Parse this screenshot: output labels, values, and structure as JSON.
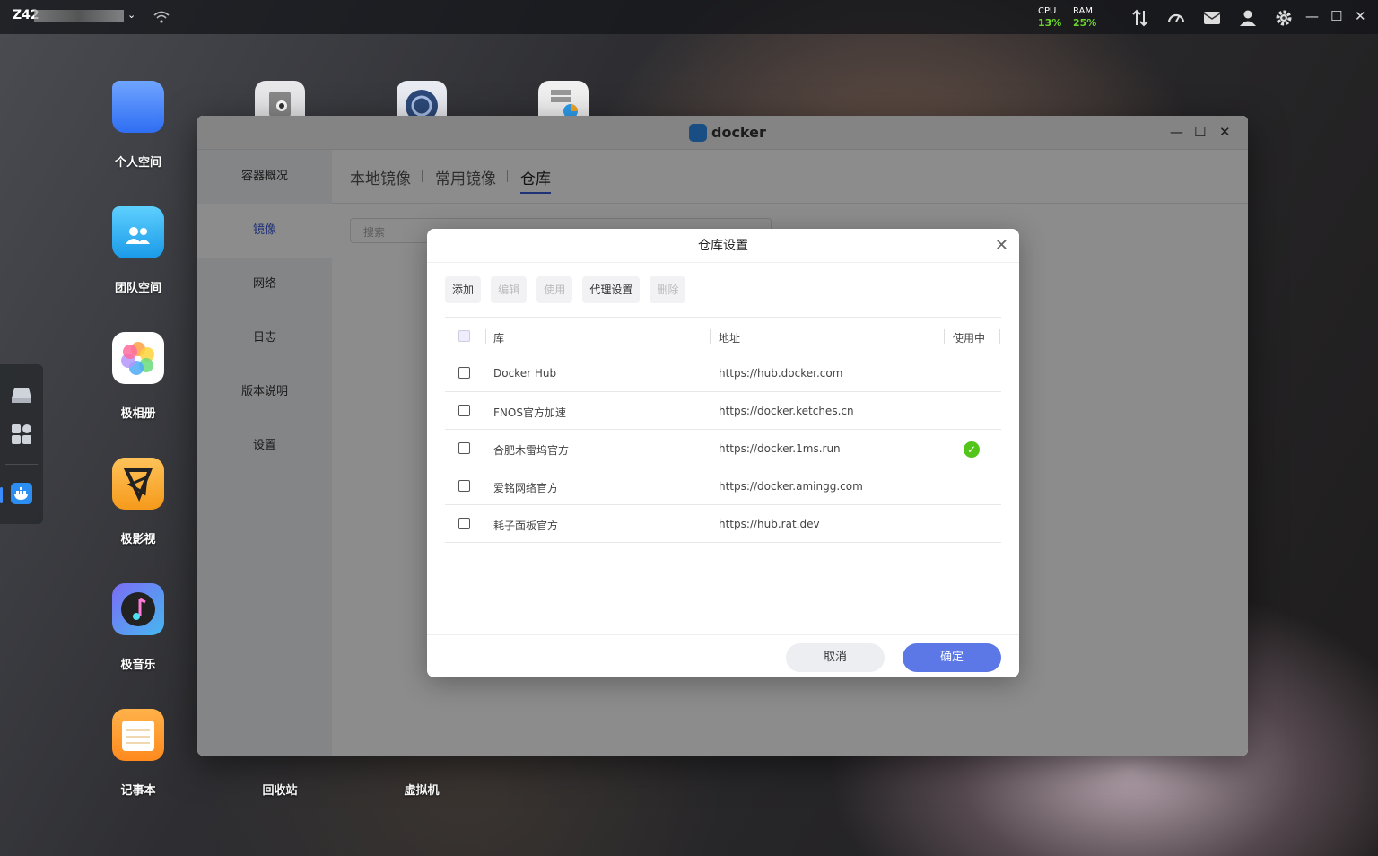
{
  "topbar": {
    "host": "Z42",
    "cpu_label": "CPU",
    "cpu_value": "13%",
    "ram_label": "RAM",
    "ram_value": "25%"
  },
  "desktop": {
    "apps": [
      {
        "label": "个人空间"
      },
      {
        "label": "团队空间"
      },
      {
        "label": "极相册"
      },
      {
        "label": "极影视"
      },
      {
        "label": "极音乐"
      },
      {
        "label": "记事本"
      },
      {
        "label": "回收站"
      },
      {
        "label": "虚拟机"
      }
    ]
  },
  "window": {
    "title": "docker",
    "sidebar": [
      "容器概况",
      "镜像",
      "网络",
      "日志",
      "版本说明",
      "设置"
    ],
    "tabs": [
      "本地镜像",
      "常用镜像",
      "仓库"
    ],
    "search_placeholder": "搜索"
  },
  "dialog": {
    "title": "仓库设置",
    "toolbar": {
      "add": "添加",
      "edit": "编辑",
      "use": "使用",
      "proxy": "代理设置",
      "delete": "删除"
    },
    "columns": {
      "repo": "库",
      "address": "地址",
      "in_use": "使用中"
    },
    "rows": [
      {
        "repo": "Docker Hub",
        "address": "https://hub.docker.com",
        "in_use": false
      },
      {
        "repo": "FNOS官方加速",
        "address": "https://docker.ketches.cn",
        "in_use": false
      },
      {
        "repo": "合肥木雷坞官方",
        "address": "https://docker.1ms.run",
        "in_use": true
      },
      {
        "repo": "爱铭网络官方",
        "address": "https://docker.amingg.com",
        "in_use": false
      },
      {
        "repo": "耗子面板官方",
        "address": "https://hub.rat.dev",
        "in_use": false
      }
    ],
    "cancel": "取消",
    "ok": "确定"
  },
  "colors": {
    "accent": "#3a5bd9",
    "ok_button": "#5b78e6",
    "in_use": "#52c41a"
  }
}
